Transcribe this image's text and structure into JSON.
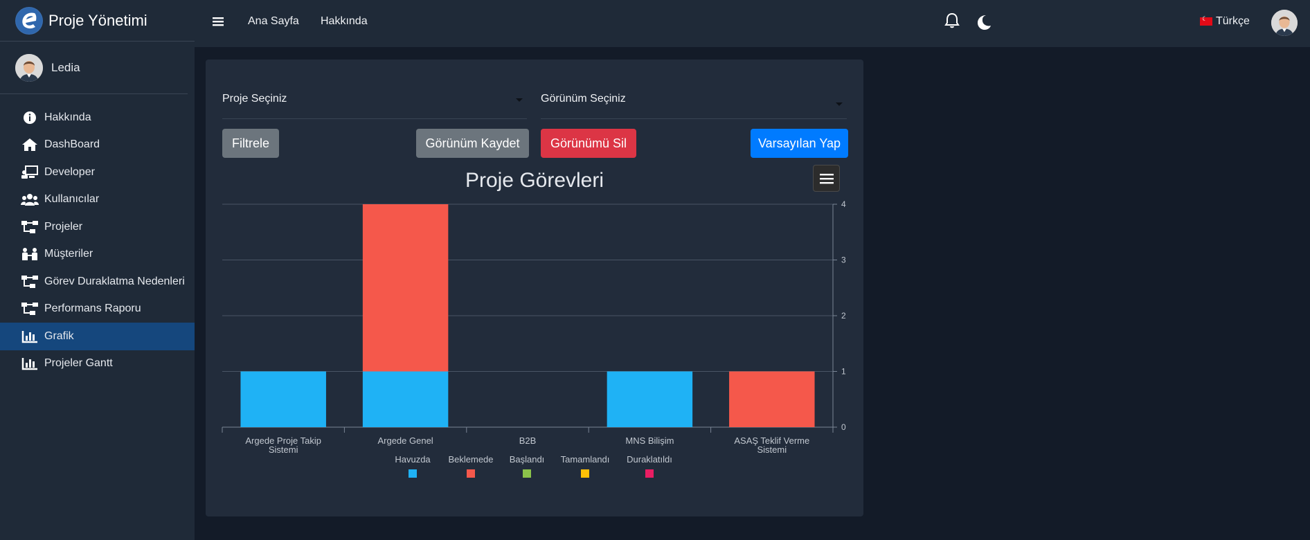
{
  "app": {
    "title": "Proje Yönetimi"
  },
  "user": {
    "name": "Ledia"
  },
  "sidebar": {
    "items": [
      {
        "label": "Hakkında",
        "icon": "info-icon"
      },
      {
        "label": "DashBoard",
        "icon": "home-icon"
      },
      {
        "label": "Developer",
        "icon": "developer-icon"
      },
      {
        "label": "Kullanıcılar",
        "icon": "users-icon"
      },
      {
        "label": "Projeler",
        "icon": "sitemap-icon"
      },
      {
        "label": "Müşteriler",
        "icon": "customers-icon"
      },
      {
        "label": "Görev Duraklatma Nedenleri",
        "icon": "sitemap-icon"
      },
      {
        "label": "Performans Raporu",
        "icon": "sitemap-icon"
      },
      {
        "label": "Grafik",
        "icon": "chart-icon",
        "active": true
      },
      {
        "label": "Projeler Gantt",
        "icon": "chart-icon"
      }
    ]
  },
  "topbar": {
    "links": [
      "Ana Sayfa",
      "Hakkında"
    ],
    "language": "Türkçe"
  },
  "filters": {
    "project_select": "Proje Seçiniz",
    "view_select": "Görünüm Seçiniz"
  },
  "buttons": {
    "filter": "Filtrele",
    "save_view": "Görünüm Kaydet",
    "delete_view": "Görünümü Sil",
    "make_default": "Varsayılan Yap"
  },
  "chart_data": {
    "type": "bar",
    "stacked": true,
    "title": "Proje Görevleri",
    "categories": [
      "Argede Proje Takip Sistemi",
      "Argede Genel",
      "B2B",
      "MNS Bilişim",
      "ASAŞ Teklif Verme Sistemi"
    ],
    "series": [
      {
        "name": "Havuzda",
        "color": "#1fb2f5",
        "values": [
          1,
          1,
          0,
          1,
          0
        ]
      },
      {
        "name": "Beklemede",
        "color": "#f5584b",
        "values": [
          0,
          3,
          0,
          0,
          1
        ]
      },
      {
        "name": "Başlandı",
        "color": "#8bc34a",
        "values": [
          0,
          0,
          0,
          0,
          0
        ]
      },
      {
        "name": "Tamamlandı",
        "color": "#ffc107",
        "values": [
          0,
          0,
          0,
          0,
          0
        ]
      },
      {
        "name": "Duraklatıldı",
        "color": "#e91e63",
        "values": [
          0,
          0,
          0,
          0,
          0
        ]
      }
    ],
    "y_ticks": [
      0,
      1,
      2,
      3,
      4
    ],
    "ylim": [
      0,
      4
    ],
    "y_axis_side": "right",
    "grid": true,
    "legend_position": "bottom-center"
  },
  "colors": {
    "sidebar_bg": "#1f2a38",
    "active_item": "#15477d",
    "page_bg": "#131b28",
    "card_bg": "#222c3b"
  }
}
